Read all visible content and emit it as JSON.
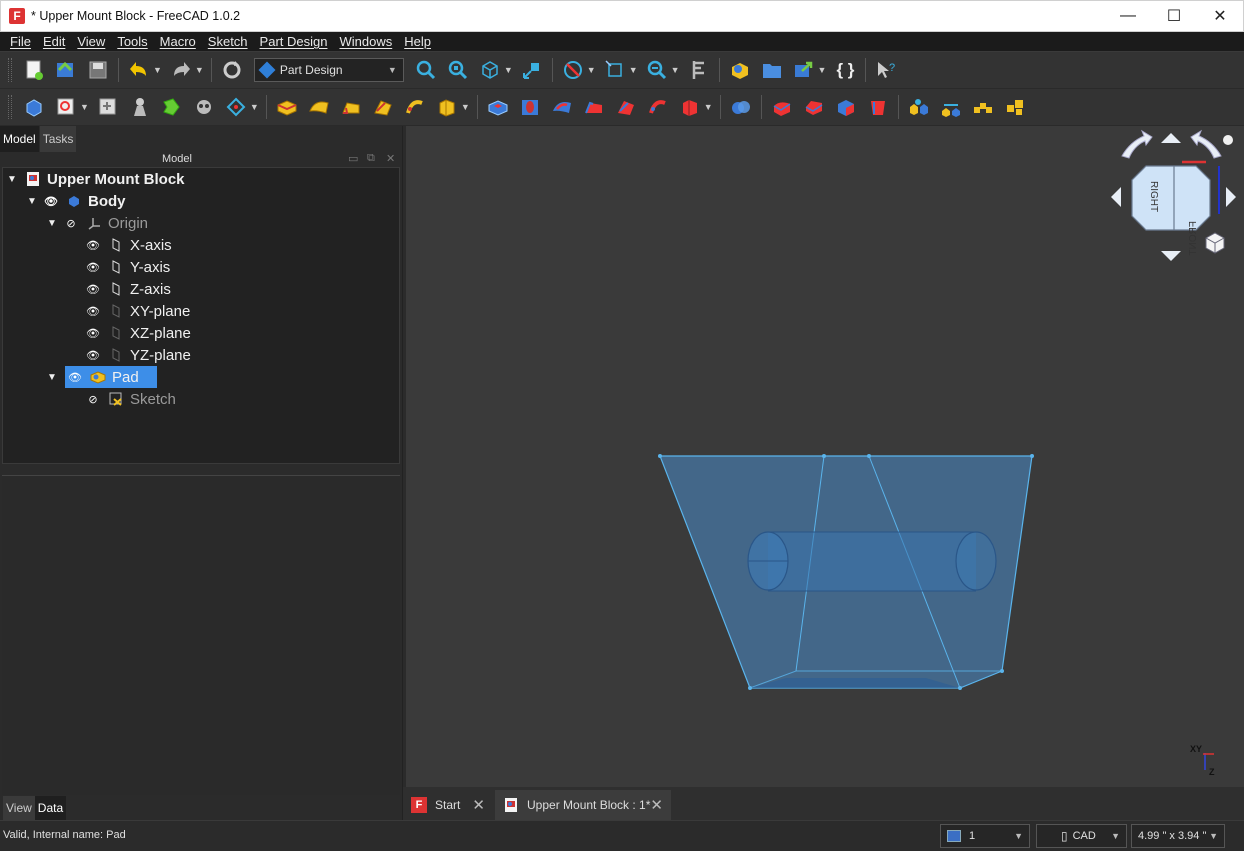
{
  "window": {
    "title": "* Upper Mount Block - FreeCAD 1.0.2",
    "minimize": "—",
    "maximize": "☐",
    "close": "✕"
  },
  "menu": [
    "File",
    "Edit",
    "View",
    "Tools",
    "Macro",
    "Sketch",
    "Part Design",
    "Windows",
    "Help"
  ],
  "toolbar": {
    "workbench": "Part Design",
    "macro_label": "{ }"
  },
  "left_panel": {
    "tabs": [
      "Model",
      "Tasks"
    ],
    "header": "Model",
    "bottom_tabs": [
      "View",
      "Data"
    ]
  },
  "tree": [
    {
      "label": "Upper Mount Block"
    },
    {
      "label": "Body"
    },
    {
      "label": "Origin"
    },
    {
      "label": "X-axis"
    },
    {
      "label": "Y-axis"
    },
    {
      "label": "Z-axis"
    },
    {
      "label": "XY-plane"
    },
    {
      "label": "XZ-plane"
    },
    {
      "label": "YZ-plane"
    },
    {
      "label": "Pad"
    },
    {
      "label": "Sketch"
    }
  ],
  "navcube": {
    "face_right": "RIGHT",
    "face_front": "FRONT"
  },
  "axis_cross": {
    "label_xy": "XY",
    "label_z": "Z"
  },
  "doc_tabs": [
    {
      "label": "Start"
    },
    {
      "label": "Upper Mount Block : 1*"
    }
  ],
  "status": {
    "message": "Valid, Internal name: Pad",
    "page_value": "1",
    "nav_style": "CAD",
    "dimensions": "4.99 \" x 3.94 \""
  }
}
